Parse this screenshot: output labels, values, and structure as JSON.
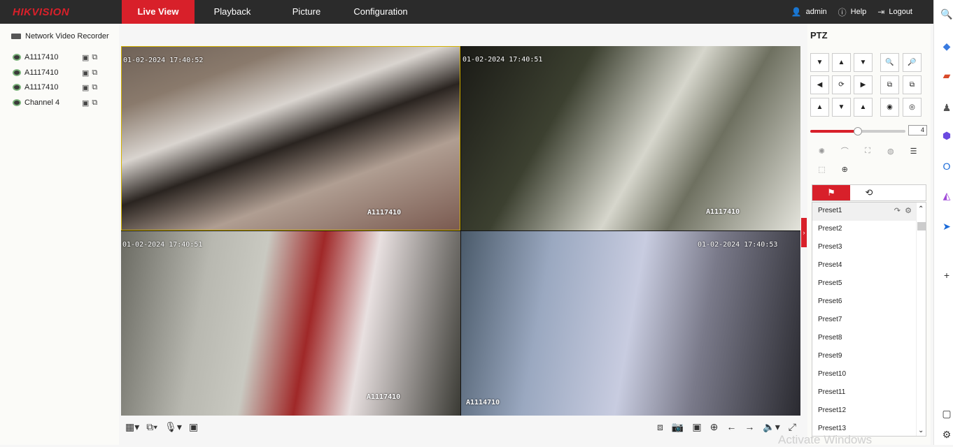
{
  "brand": "HIKVISION",
  "nav": [
    "Live View",
    "Playback",
    "Picture",
    "Configuration"
  ],
  "user": {
    "name": "admin",
    "help": "Help",
    "logout": "Logout"
  },
  "device_tree": {
    "root": "Network Video Recorder",
    "channels": [
      "A1117410",
      "A1117410",
      "A1117410",
      "Channel 4"
    ]
  },
  "tiles": [
    {
      "timestamp": "01-02-2024 17:40:52",
      "name": "A1117410"
    },
    {
      "timestamp": "01-02-2024 17:40:51",
      "name": "A1117410"
    },
    {
      "timestamp": "01-02-2024 17:40:51",
      "name": "A1117410"
    },
    {
      "timestamp": "01-02-2024 17:40:53",
      "name": "A1114710"
    }
  ],
  "ptz": {
    "title": "PTZ",
    "speed": "4",
    "speed_fraction": 0.5,
    "presets": [
      "Preset1",
      "Preset2",
      "Preset3",
      "Preset4",
      "Preset5",
      "Preset6",
      "Preset7",
      "Preset8",
      "Preset9",
      "Preset10",
      "Preset11",
      "Preset12",
      "Preset13"
    ]
  },
  "watermark": "Activate Windows",
  "colors": {
    "accent": "#d8202a",
    "topbar": "#2b2b2b"
  }
}
